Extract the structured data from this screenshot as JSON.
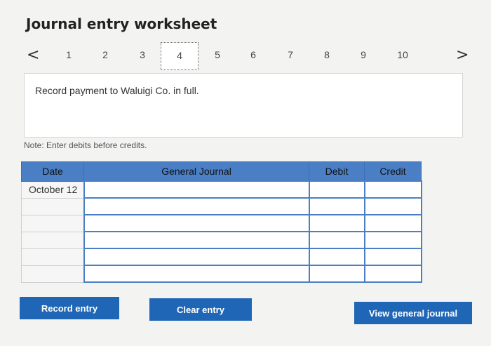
{
  "title": "Journal entry worksheet",
  "pager": {
    "prev": "<",
    "next": ">",
    "pages": [
      "1",
      "2",
      "3",
      "4",
      "5",
      "6",
      "7",
      "8",
      "9",
      "10"
    ],
    "active": 4
  },
  "prompt": "Record payment to Waluigi Co. in full.",
  "note": "Note: Enter debits before credits.",
  "table": {
    "headers": {
      "date": "Date",
      "journal": "General Journal",
      "debit": "Debit",
      "credit": "Credit"
    },
    "rows": [
      {
        "date": "October 12",
        "account": "",
        "debit": "",
        "credit": ""
      },
      {
        "date": "",
        "account": "",
        "debit": "",
        "credit": ""
      },
      {
        "date": "",
        "account": "",
        "debit": "",
        "credit": ""
      },
      {
        "date": "",
        "account": "",
        "debit": "",
        "credit": ""
      },
      {
        "date": "",
        "account": "",
        "debit": "",
        "credit": ""
      },
      {
        "date": "",
        "account": "",
        "debit": "",
        "credit": ""
      }
    ]
  },
  "buttons": {
    "record": "Record entry",
    "clear": "Clear entry",
    "view": "View general journal"
  }
}
